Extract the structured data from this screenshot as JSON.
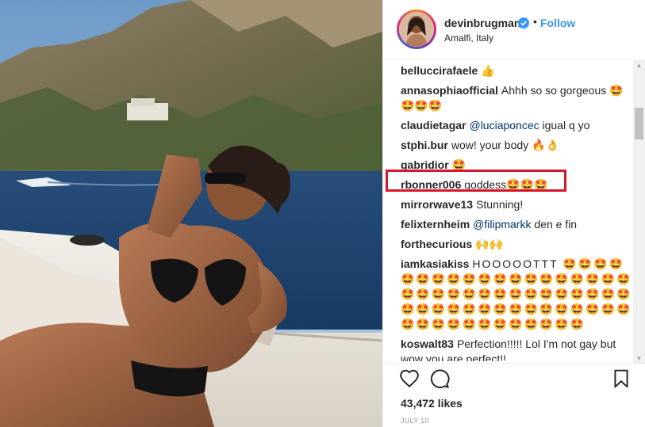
{
  "post": {
    "username": "devinbrugman",
    "follow_label": "Follow",
    "separator": "•",
    "location": "Amalfi, Italy",
    "likes": "43,472 likes",
    "date": "JULY 10"
  },
  "comments": [
    {
      "user": "belluccirafaele",
      "text": "👍"
    },
    {
      "user": "annasophiaofficial",
      "text": "Ahhh so so gorgeous 🤩🤩🤩🤩"
    },
    {
      "user": "claudietagar",
      "mention": "@luciaponcec",
      "text": " igual q yo"
    },
    {
      "user": "stphi.bur",
      "text": "wow! your body 🔥👌"
    },
    {
      "user": "gabridior",
      "text": "🤩"
    },
    {
      "user": "rbonner006",
      "text": "goddess🤩🤩🤩"
    },
    {
      "user": "mirrorwave13",
      "text": "Stunning!"
    },
    {
      "user": "felixternheim",
      "mention": "@filipmarkk",
      "text": " den e fin"
    },
    {
      "user": "forthecurious",
      "text": "🙌🙌"
    },
    {
      "user": "iamkasiakiss",
      "text": "HOOOOOTTT 🤩🤩🤩🤩🤩🤩🤩🤩🤩🤩🤩🤩🤩🤩🤩🤩🤩🤩🤩🤩🤩🤩🤩🤩🤩🤩🤩🤩🤩🤩🤩🤩🤩🤩🤩🤩🤩🤩🤩🤩🤩🤩🤩🤩🤩🤩🤩🤩🤩🤩🤩🤩🤩🤩🤩🤩🤩🤩🤩🤩🤩"
    },
    {
      "user": "koswalt83",
      "text": "Perfection!!!!! Lol I'm not gay but wow you are perfect!!"
    }
  ],
  "icons": {
    "verified": "verified-badge-icon",
    "like": "heart-icon",
    "comment": "comment-bubble-icon",
    "save": "bookmark-icon"
  },
  "colors": {
    "follow": "#3897f0",
    "highlight": "#d9152c",
    "text": "#262626",
    "muted": "#999999"
  }
}
